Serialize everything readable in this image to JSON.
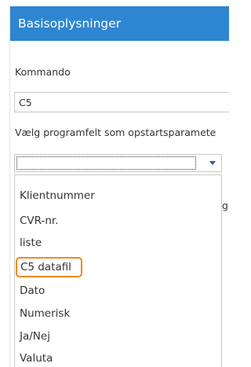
{
  "header": {
    "title": "Basisoplysninger"
  },
  "command": {
    "label": "Kommando",
    "value": "C5"
  },
  "startup": {
    "label": "Vælg programfelt som opstartsparamete"
  },
  "dropdown": {
    "selected_value": "",
    "options": [
      "Klientnummer",
      "CVR-nr.",
      "liste",
      "C5 datafil",
      "Dato",
      "Numerisk",
      "Ja/Nej",
      "Valuta"
    ],
    "highlighted_option": "C5 datafil",
    "highlight_color": "#ef8a22"
  },
  "background": {
    "partial_text": "gr"
  },
  "colors": {
    "header_bg": "#2e86d0",
    "header_text": "#ffffff",
    "dropdown_arrow": "#1f5f9c"
  },
  "icons": {
    "dropdown": "chevron-down-icon"
  }
}
